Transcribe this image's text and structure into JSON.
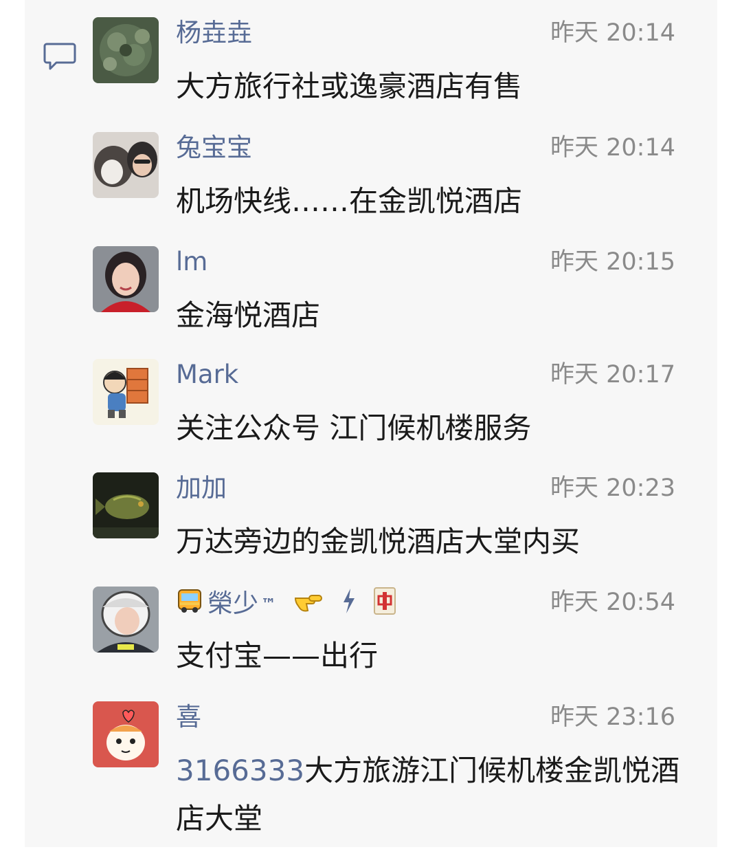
{
  "feed": {
    "items": [
      {
        "name": "杨垚垚",
        "time": "昨天 20:14",
        "text": "大方旅行社或逸豪酒店有售"
      },
      {
        "name": "兔宝宝",
        "time": "昨天 20:14",
        "text": "机场快线……在金凯悦酒店"
      },
      {
        "name": "lm",
        "time": "昨天 20:15",
        "text": "金海悦酒店"
      },
      {
        "name": "Mark",
        "time": "昨天 20:17",
        "text": "关注公众号 江门候机楼服务"
      },
      {
        "name": "加加",
        "time": "昨天 20:23",
        "text": "万达旁边的金凯悦酒店大堂内买"
      },
      {
        "name": "榮少",
        "name_suffix": "™",
        "time": "昨天 20:54",
        "text": "支付宝——出行"
      },
      {
        "name": "喜",
        "time": "昨天 23:16",
        "text_link": "3166333",
        "text": "大方旅游江门候机楼金凯悦酒店大堂"
      }
    ]
  },
  "icons": {
    "comment": "comment-bubble-icon",
    "bus": "bus-emoji-icon",
    "pointing": "pointing-hand-emoji-icon",
    "mahjong": "mahjong-red-dragon-icon"
  },
  "colors": {
    "name_link": "#576b95",
    "time": "#8a8a8a",
    "text": "#1a1a1a",
    "panel_bg": "#f7f7f7"
  }
}
